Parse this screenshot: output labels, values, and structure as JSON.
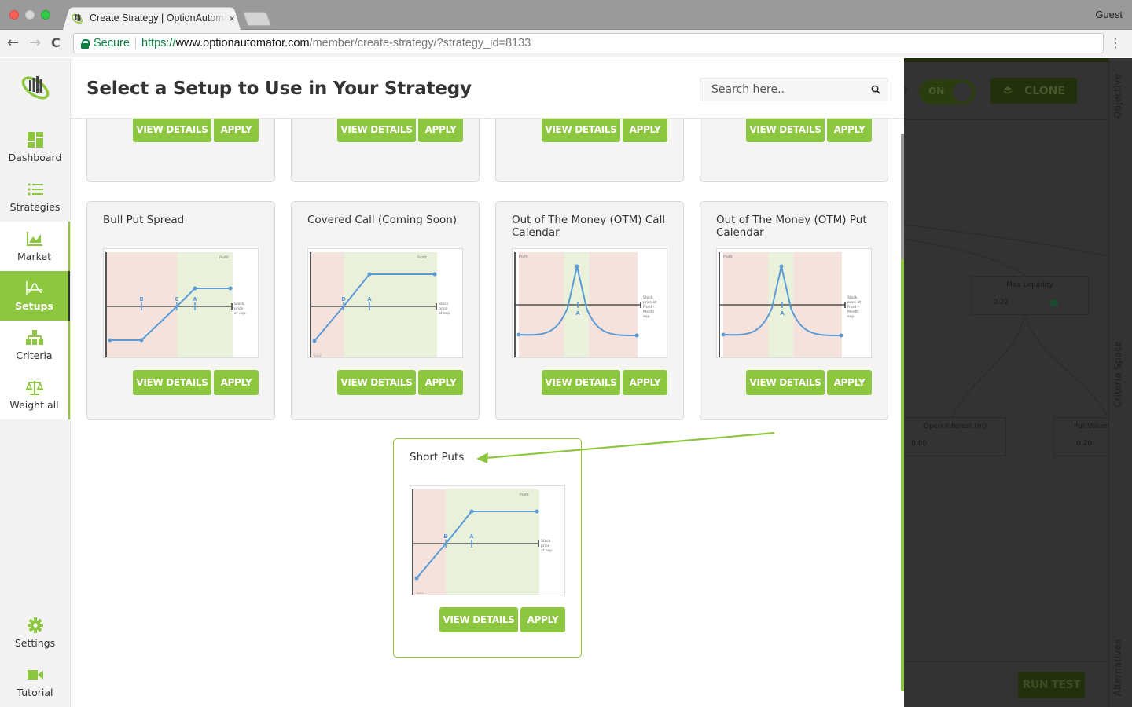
{
  "browser": {
    "tab_title": "Create Strategy | OptionAutomator",
    "tab_close": "×",
    "profile": "Guest",
    "secure_label": "Secure",
    "url_scheme": "https://",
    "url_host": "www.optionautomator.com",
    "url_path": "/member/create-strategy/?strategy_id=8133",
    "back": "←",
    "forward": "→",
    "reload": "C",
    "menu": "⋮"
  },
  "sidebar": {
    "items": [
      {
        "label": "Dashboard",
        "icon": "dashboard-icon"
      },
      {
        "label": "Strategies",
        "icon": "list-icon"
      },
      {
        "label": "Market",
        "icon": "line-chart-icon"
      },
      {
        "label": "Setups",
        "icon": "setup-curve-icon",
        "active": true
      },
      {
        "label": "Criteria",
        "icon": "hierarchy-icon"
      },
      {
        "label": "Weight all",
        "icon": "scale-icon"
      }
    ],
    "bottom_items": [
      {
        "label": "Settings",
        "icon": "gear-icon"
      },
      {
        "label": "Tutorial",
        "icon": "video-camera-icon"
      }
    ],
    "accent_color": "#8dc63f"
  },
  "modal": {
    "title": "Select a Setup to Use in Your Strategy",
    "search_placeholder": "Search here..",
    "search_value": "",
    "view_details_label": "VIEW DETAILS",
    "apply_label": "APPLY",
    "cards_top_partial": [
      {
        "title": ""
      },
      {
        "title": ""
      },
      {
        "title": ""
      },
      {
        "title": ""
      }
    ],
    "cards": [
      {
        "title": "Bull Put Spread",
        "chart": {
          "type": "bull-put-spread",
          "markers": [
            "B",
            "C",
            "A"
          ],
          "profit_label": "Profit",
          "axis_label": "Stock price at exp."
        }
      },
      {
        "title": "Covered Call (Coming Soon)",
        "chart": {
          "type": "covered-call",
          "markers": [
            "B",
            "A"
          ],
          "profit_label": "Profit",
          "axis_label": "Stock price at exp.",
          "loss_label": "Loss"
        }
      },
      {
        "title": "Out of The Money (OTM) Call Calendar",
        "chart": {
          "type": "calendar",
          "markers": [
            "A"
          ],
          "profit_label": "Profit",
          "axis_label": "Stock price at Front-Month exp."
        }
      },
      {
        "title": "Out of The Money (OTM) Put Calendar",
        "chart": {
          "type": "calendar",
          "markers": [
            "A"
          ],
          "profit_label": "Profit",
          "axis_label": "Stock price at Front-Month exp."
        }
      }
    ],
    "highlighted_card": {
      "title": "Short Puts",
      "chart": {
        "type": "short-puts",
        "markers": [
          "B",
          "A"
        ],
        "profit_label": "Profit",
        "axis_label": "Stock price at exp.",
        "loss_label": "Loss"
      }
    }
  },
  "background": {
    "toggle_label": "ON",
    "clone_label": "CLONE",
    "run_test_label": "RUN TEST",
    "vertical_tabs": [
      "Objective",
      "Criteria Space",
      "Alternatives"
    ],
    "nodes": [
      {
        "title": "Max Liquidity",
        "value": "0.22",
        "checked": true
      },
      {
        "title": "Open Interest (m)",
        "value": "0.80"
      },
      {
        "title": "Put Volum",
        "value": "0.20"
      }
    ]
  }
}
